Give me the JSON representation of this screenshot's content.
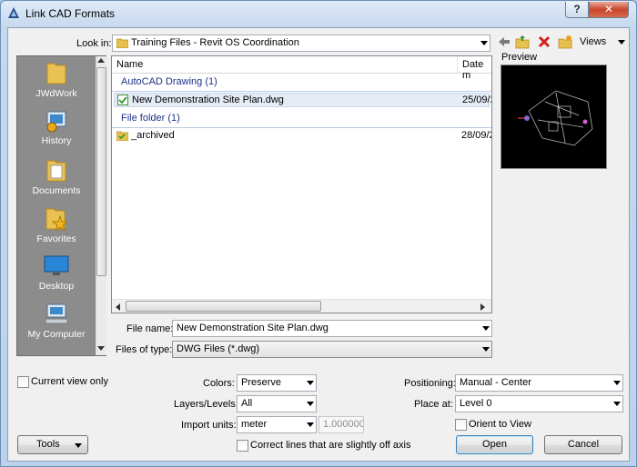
{
  "window": {
    "title": "Link CAD Formats",
    "help": "?"
  },
  "lookin": {
    "label": "Look in:",
    "value": "Training Files - Revit OS Coordination",
    "views": "Views"
  },
  "places": [
    {
      "label": "JWdWork",
      "icon": "folder-icon"
    },
    {
      "label": "History",
      "icon": "history-icon"
    },
    {
      "label": "Documents",
      "icon": "documents-folder-icon"
    },
    {
      "label": "Favorites",
      "icon": "favorites-folder-icon"
    },
    {
      "label": "Desktop",
      "icon": "desktop-icon"
    },
    {
      "label": "My Computer",
      "icon": "computer-icon"
    }
  ],
  "filelist": {
    "columns": [
      "Name",
      "Date m"
    ],
    "groups": [
      {
        "label": "AutoCAD Drawing (1)",
        "items": [
          {
            "name": "New Demonstration Site Plan.dwg",
            "date": "25/09/2"
          }
        ]
      },
      {
        "label": "File folder (1)",
        "items": [
          {
            "name": "_archived",
            "date": "28/09/2"
          }
        ]
      }
    ]
  },
  "preview": {
    "label": "Preview"
  },
  "filename": {
    "label": "File name:",
    "value": "New Demonstration Site Plan.dwg"
  },
  "filetype": {
    "label": "Files of type:",
    "value": "DWG Files  (*.dwg)"
  },
  "options": {
    "current_view_only": "Current view only",
    "colors_label": "Colors:",
    "colors_value": "Preserve",
    "layers_label": "Layers/Levels:",
    "layers_value": "All",
    "units_label": "Import units:",
    "units_value": "meter",
    "scale_value": "1.000000",
    "correct_lines": "Correct lines that are slightly off axis",
    "positioning_label": "Positioning:",
    "positioning_value": "Manual - Center",
    "placeat_label": "Place at:",
    "placeat_value": "Level 0",
    "orient_label": "Orient to View"
  },
  "buttons": {
    "tools": "Tools",
    "open": "Open",
    "cancel": "Cancel"
  }
}
